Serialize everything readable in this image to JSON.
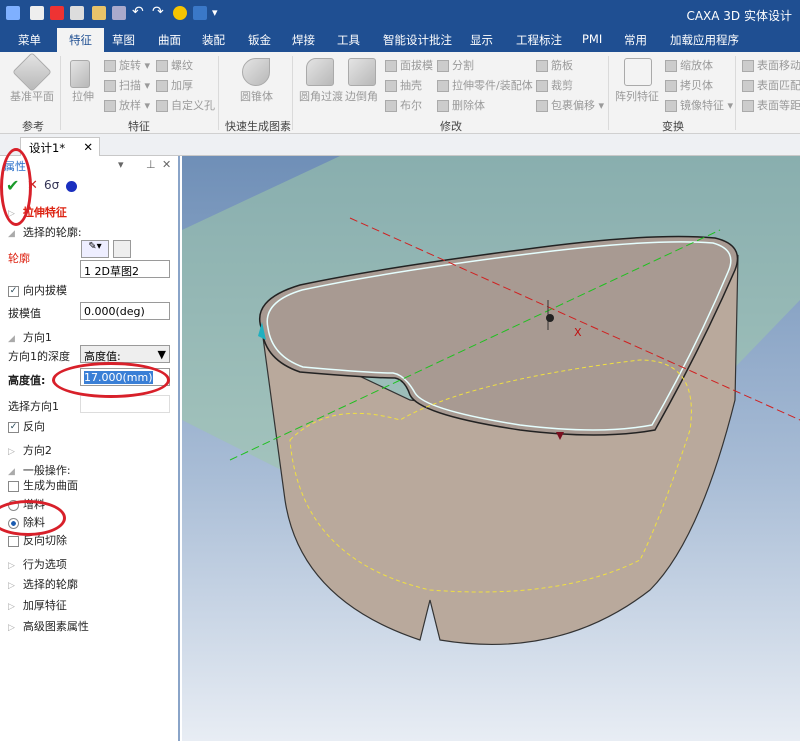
{
  "app_title": "CAXA 3D 实体设计",
  "quick_access": [
    "app-menu-icon",
    "new-icon",
    "close-doc-icon",
    "doc-icon",
    "open-icon",
    "save-icon",
    "undo-icon",
    "redo-icon",
    "bulb-icon",
    "tree-icon",
    "dropdown-icon"
  ],
  "tabs": [
    "菜单",
    "特征",
    "草图",
    "曲面",
    "装配",
    "钣金",
    "焊接",
    "工具",
    "智能设计批注",
    "显示",
    "工程标注",
    "PMI",
    "常用",
    "加载应用程序"
  ],
  "ribbon": {
    "ref": {
      "big": "基准平面",
      "group": "参考"
    },
    "feature": {
      "big": "拉伸",
      "items": [
        "旋转",
        "扫描",
        "放样",
        "螺纹",
        "加厚",
        "自定义孔"
      ],
      "group": "特征"
    },
    "quick": {
      "big": "圆锥体",
      "group": "快速生成图素"
    },
    "modify": {
      "big1": "圆角过渡",
      "big2": "边倒角",
      "items": [
        "面拔模",
        "抽壳",
        "布尔",
        "分割",
        "拉伸零件/装配体",
        "删除体",
        "筋板",
        "裁剪",
        "包裹偏移"
      ],
      "group": "修改"
    },
    "transform": {
      "big": "阵列特征",
      "items": [
        "缩放体",
        "拷贝体",
        "镜像特征"
      ],
      "group": "变换"
    },
    "direct": {
      "items": [
        "表面移动",
        "表面匹配",
        "表面等距"
      ]
    }
  },
  "doc_tab": "设计1*",
  "panel": {
    "title": "属性",
    "feature_title": "拉伸特征",
    "sec_profile": "选择的轮廓:",
    "profile_label": "轮廓",
    "profile_value": "1    2D草图2",
    "draft_inward": "向内拔模",
    "draft_label": "拔模值",
    "draft_value": "0.000(deg)",
    "dir1": "方向1",
    "depth_label": "方向1的深度",
    "depth_value": "高度值:",
    "height_label": "高度值:",
    "height_value": "17.000(mm)",
    "select_dir": "选择方向1",
    "reverse": "反向",
    "dir2": "方向2",
    "general": "一般操作:",
    "as_surface": "生成为曲面",
    "add": "增料",
    "remove": "除料",
    "reverse_cut": "反向切除",
    "behavior": "行为选项",
    "sel_profile2": "选择的轮廓",
    "thicken": "加厚特征",
    "advanced": "高级图素属性"
  },
  "axis_label": "X"
}
